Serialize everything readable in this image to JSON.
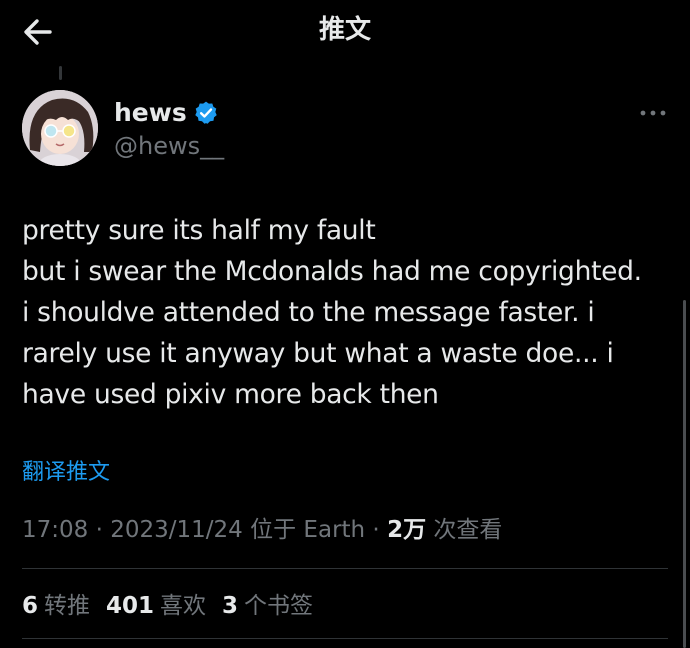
{
  "header": {
    "title": "推文"
  },
  "author": {
    "name": "hews",
    "handle": "@hews__",
    "verified_color": "#1d9bf0"
  },
  "tweet": {
    "text": "pretty sure its half my fault\nbut i swear the Mcdonalds had me copyrighted.\ni shouldve attended to the message faster. i\nrarely use it anyway but what a waste doe... i\nhave used pixiv more back then",
    "translate_label": "翻译推文"
  },
  "meta": {
    "time": "17:08",
    "date": "2023/11/24",
    "location": "位于 Earth",
    "views_count": "2万",
    "views_label": "次查看"
  },
  "stats": {
    "retweets_count": "6",
    "retweets_label": "转推",
    "likes_count": "401",
    "likes_label": "喜欢",
    "bookmarks_count": "3",
    "bookmarks_label": "个书签"
  },
  "colors": {
    "background": "#000000",
    "text_primary": "#e7e9ea",
    "text_secondary": "#71767b",
    "accent": "#1d9bf0"
  }
}
